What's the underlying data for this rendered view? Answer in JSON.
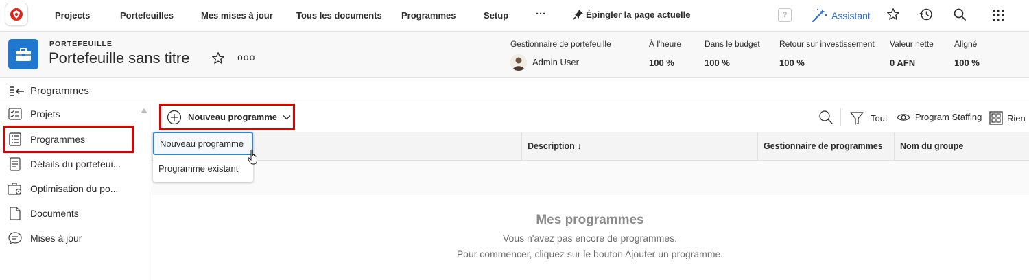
{
  "topnav": {
    "items": [
      "Projects",
      "Portefeuilles",
      "Mes mises à jour",
      "Tous les documents",
      "Programmes",
      "Setup"
    ],
    "more": "···",
    "pin_label": "Épingler la page actuelle",
    "help": "?",
    "assistant": "Assistant"
  },
  "header": {
    "kind": "PORTEFEUILLE",
    "title": "Portefeuille sans titre",
    "more": "ooo",
    "kpis": [
      {
        "label": "Gestionnaire de portefeuille",
        "value": "Admin User"
      },
      {
        "label": "À l'heure",
        "value": "100 %"
      },
      {
        "label": "Dans le budget",
        "value": "100 %"
      },
      {
        "label": "Retour sur investissement",
        "value": "100 %"
      },
      {
        "label": "Valeur nette",
        "value": "0 AFN"
      },
      {
        "label": "Aligné",
        "value": "100 %"
      }
    ]
  },
  "section": {
    "title": "Programmes"
  },
  "sidebar": {
    "items": [
      {
        "label": "Projets",
        "icon": "checklist-icon"
      },
      {
        "label": "Programmes",
        "icon": "list-icon"
      },
      {
        "label": "Détails du portefeui...",
        "icon": "document-icon"
      },
      {
        "label": "Optimisation du po...",
        "icon": "optimize-icon"
      },
      {
        "label": "Documents",
        "icon": "file-icon"
      },
      {
        "label": "Mises à jour",
        "icon": "chat-icon"
      }
    ]
  },
  "toolbar": {
    "new_program": "Nouveau programme",
    "filter": "Tout",
    "view": "Program Staffing",
    "group": "Rien"
  },
  "table": {
    "columns": [
      "Description ↓",
      "Gestionnaire de programmes",
      "Nom du groupe"
    ]
  },
  "dropdown": {
    "items": [
      "Nouveau programme",
      "Programme existant"
    ]
  },
  "empty": {
    "title": "Mes programmes",
    "line1": "Vous n'avez pas encore de programmes.",
    "line2": "Pour commencer, cliquez sur le bouton Ajouter un programme."
  }
}
